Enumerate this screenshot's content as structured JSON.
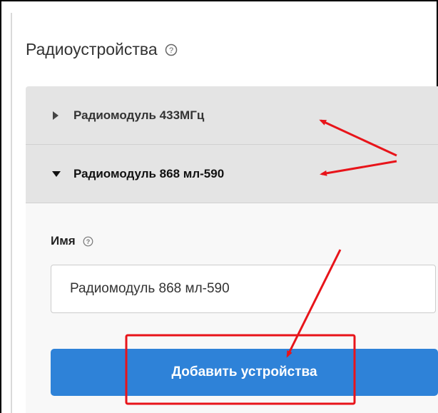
{
  "section": {
    "title": "Радиоустройства",
    "help_icon": "question-circle-icon"
  },
  "accordion": {
    "items": [
      {
        "label": "Радиомодуль 433МГц",
        "state": "collapsed",
        "icon": "caret-right-icon"
      },
      {
        "label": "Радиомодуль 868 мл-590",
        "state": "expanded",
        "icon": "caret-down-icon"
      }
    ]
  },
  "form": {
    "name_label": "Имя",
    "name_help_icon": "question-circle-icon",
    "name_value": "Радиомодуль 868 мл-590",
    "submit_label": "Добавить устройства"
  },
  "annotations": {
    "arrow_color": "#e8141a",
    "highlight_color": "#e8141a"
  },
  "colors": {
    "button_bg": "#2e82d8",
    "accordion_header_bg": "#e4e4e4",
    "panel_bg": "#f8f8f8"
  }
}
